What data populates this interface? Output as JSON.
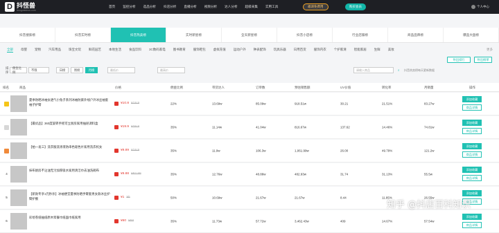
{
  "brand": {
    "name": "抖怪兽",
    "sub": "douguaishou.com"
  },
  "nav": [
    "首页",
    "监控分析",
    "选品分析",
    "抖店分析",
    "直播分析",
    "视频分析",
    "达人分析",
    "超级采集",
    "实用工具"
  ],
  "invite": "邀请免费用",
  "vip": "购买会员",
  "user": "个人中心",
  "rank_tabs": [
    "抖音搜索榜",
    "抖音实时榜",
    "抖音热卖榜",
    "实时新星榜",
    "全天新星榜",
    "抖音小店榜",
    "行业店铺榜",
    "商品品牌榜",
    "爆品大盘榜"
  ],
  "active_rank_tab": 2,
  "categories": [
    "全部",
    "母婴",
    "宠物",
    "汽车用品",
    "珠宝文玩",
    "鲜花园艺",
    "本地生活",
    "食品饮料",
    "3C数码家电",
    "图书教育",
    "服饰鞋包",
    "虚拟充值",
    "运动户外",
    "钟表配饰",
    "玩具乐器",
    "日用百货",
    "服饰内衣",
    "个护家清",
    "智能家居",
    "生鲜",
    "美妆"
  ],
  "more": "更多",
  "buttons": {
    "export": "导出榜单",
    "export2": "导出排行",
    "search_btn": "搜索"
  },
  "filters": {
    "sort_label": "排序",
    "sort_val": "佣金比例",
    "time_val": "不限",
    "chips": [
      "日榜",
      "周榜",
      "月榜"
    ],
    "active_chip": 2,
    "range_ph1": "最低价",
    "range_ph2": "最高价",
    "date_ph": "日期",
    "search_ph": "请输入商品",
    "hint": "抖音热卖榜每天更新数据"
  },
  "columns": [
    "排名",
    "商品",
    "价格",
    "佣金比例",
    "带货达人",
    "订单数",
    "预估销售额",
    "UV价值",
    "转化率",
    "月销量",
    "操作"
  ],
  "rows": [
    {
      "rank": "1",
      "name": "夏季防晒冰袖女透气小兔子系列冰袖防紫外线户外冰丝袖套袖子护臂",
      "price": "¥10.8",
      "orig": "¥19.9",
      "ratio": "22%",
      "talent": "13.69w",
      "orders": "85.09w",
      "sales": "918.51w",
      "uv": "30.21",
      "conv": "21.51%",
      "month": "83.27w"
    },
    {
      "rank": "2",
      "name": "【最优品】360度旋转手摇可立厨房家用抽屉调料盒",
      "price": "¥19.9",
      "orig": "¥29.9",
      "ratio": "35%",
      "talent": "11.14w",
      "orders": "41.04w",
      "sales": "816.67w",
      "uv": "137.62",
      "conv": "14.46%",
      "month": "74.81w"
    },
    {
      "rank": "3",
      "name": "【拍一发三】洗衣服洗涤液防串色吸色片家用洗衣机女",
      "price": "¥9.89",
      "orig": "¥19.9",
      "ratio": "35%",
      "talent": "11.9w",
      "orders": "106.3w",
      "sales": "1,061.99w",
      "uv": "26.00",
      "conv": "49.79%",
      "month": "121.2w"
    },
    {
      "rank": "4",
      "name": "抹布厨房不沾油无污加厚吸水家用清洁巾去油洗碗布",
      "price": "¥9.88",
      "orig": "¥82.88",
      "ratio": "35%",
      "talent": "12.76w",
      "orders": "48.88w",
      "sales": "482.93w",
      "uv": "31.74",
      "conv": "31.13%",
      "month": "55.5w"
    },
    {
      "rank": "5",
      "name": "【新款专享1元秒杀】冰袖便宜夏季防晒手臂套男女款冰丝护臂护腕",
      "price": "¥1",
      "orig": "¥5",
      "ratio": "50%",
      "talent": "10.69w",
      "orders": "21.67w",
      "sales": "21.67w",
      "uv": "8.44",
      "conv": "11.85%",
      "month": "26.55w"
    },
    {
      "rank": "6",
      "name": "彩绘卷纸抽纸原木浆餐巾纸面巾纸家用",
      "price": "¥60",
      "orig": "¥68",
      "ratio": "35%",
      "talent": "11.73w",
      "orders": "57.72w",
      "sales": "3,462.43w",
      "uv": "409",
      "conv": "14.67%",
      "month": "57.54w"
    }
  ],
  "row_actions": {
    "primary": "添加收藏",
    "secondary": "商品详情"
  },
  "watermark": "知乎 @抖店百科知识",
  "colors": {
    "accent": "#20c1b3",
    "topbar": "#1e1f24",
    "price": "#e2362d"
  }
}
